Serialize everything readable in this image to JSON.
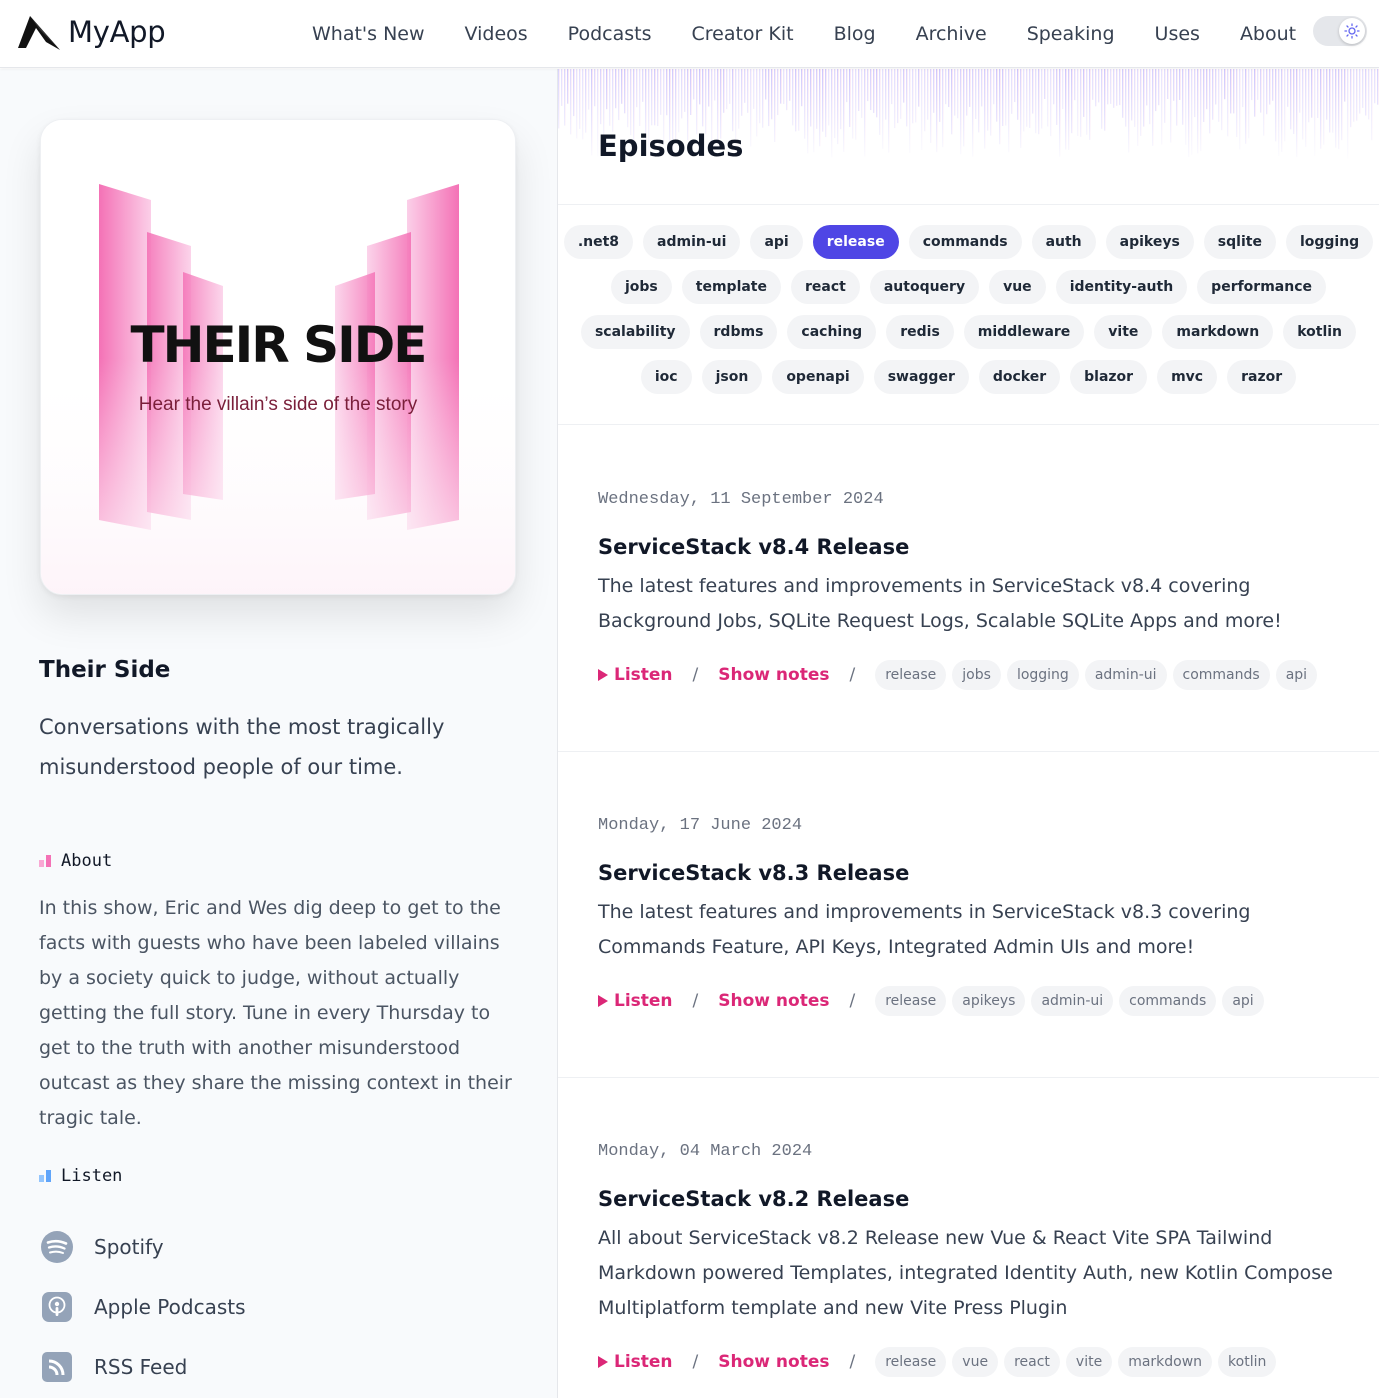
{
  "header": {
    "app_name": "MyApp",
    "nav": [
      "What's New",
      "Videos",
      "Podcasts",
      "Creator Kit",
      "Blog",
      "Archive",
      "Speaking",
      "Uses",
      "About"
    ],
    "theme_toggle_icon": "sun-icon"
  },
  "podcast": {
    "cover_title": "THEIR SIDE",
    "cover_subtitle": "Hear the villain’s side of the story",
    "title": "Their Side",
    "tagline": "Conversations with the most tragically misunderstood people of our time.",
    "about_label": "About",
    "about_text": "In this show, Eric and Wes dig deep to get to the facts with guests who have been labeled villains by a society quick to judge, without actually getting the full story. Tune in every Thursday to get to the truth with another misunderstood outcast as they share the missing context in their tragic tale.",
    "listen_label": "Listen",
    "listen_links": [
      {
        "label": "Spotify",
        "icon": "spotify-icon"
      },
      {
        "label": "Apple Podcasts",
        "icon": "apple-podcasts-icon"
      },
      {
        "label": "RSS Feed",
        "icon": "rss-icon"
      }
    ]
  },
  "episodes_title": "Episodes",
  "tags": {
    "active": "release",
    "rows": [
      [
        ".net8",
        "admin-ui",
        "api",
        "release",
        "commands",
        "auth",
        "apikeys",
        "sqlite",
        "logging"
      ],
      [
        "jobs",
        "template",
        "react",
        "autoquery",
        "vue",
        "identity-auth",
        "performance"
      ],
      [
        "scalability",
        "rdbms",
        "caching",
        "redis",
        "middleware",
        "vite",
        "markdown",
        "kotlin"
      ],
      [
        "ioc",
        "json",
        "openapi",
        "swagger",
        "docker",
        "blazor",
        "mvc",
        "razor"
      ]
    ]
  },
  "episode_actions": {
    "listen": "Listen",
    "show_notes": "Show notes",
    "separator": "/"
  },
  "episodes": [
    {
      "date": "Wednesday, 11 September 2024",
      "title": "ServiceStack v8.4 Release",
      "description": "The latest features and improvements in ServiceStack v8.4 covering Background Jobs, SQLite Request Logs, Scalable SQLite Apps and more!",
      "tags": [
        "release",
        "jobs",
        "logging",
        "admin-ui",
        "commands",
        "api"
      ]
    },
    {
      "date": "Monday, 17 June 2024",
      "title": "ServiceStack v8.3 Release",
      "description": "The latest features and improvements in ServiceStack v8.3 covering Commands Feature, API Keys, Integrated Admin UIs and more!",
      "tags": [
        "release",
        "apikeys",
        "admin-ui",
        "commands",
        "api"
      ]
    },
    {
      "date": "Monday, 04 March 2024",
      "title": "ServiceStack v8.2 Release",
      "description": "All about ServiceStack v8.2 Release new Vue & React Vite SPA Tailwind Markdown powered Templates, integrated Identity Auth, new Kotlin Compose Multiplatform template and new Vite Press Plugin",
      "tags": [
        "release",
        "vue",
        "react",
        "vite",
        "markdown",
        "kotlin"
      ]
    }
  ],
  "colors": {
    "accent": "#db2777",
    "active_tag": "#4f46e5"
  }
}
